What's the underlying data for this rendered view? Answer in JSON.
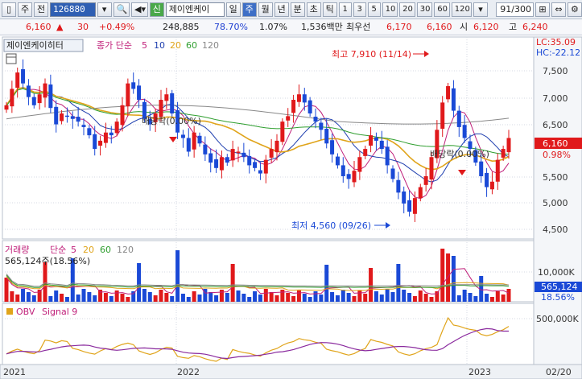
{
  "toolbar": {
    "mode": "주",
    "prev_label": "전",
    "code": "126880",
    "shin_label": "신",
    "stock_name": "제이엔케이",
    "periods": [
      "일",
      "주",
      "월",
      "년",
      "분",
      "초",
      "틱"
    ],
    "active_period": "주",
    "intervals": [
      "1",
      "3",
      "5",
      "10",
      "20",
      "30",
      "60",
      "120"
    ],
    "count": "91",
    "count_total": "/300"
  },
  "quote": {
    "price": "6,160",
    "change": "30",
    "change_pct": "+0.49%",
    "volume": "248,885",
    "ratio1": "78.70%",
    "ratio2": "1.07%",
    "amount": "1,536백만",
    "best_ask_label": "최우선",
    "best_ask": "6,170",
    "best_bid": "6,160",
    "open_label": "시",
    "open": "6,120",
    "high_label": "고",
    "high": "6,240"
  },
  "chart_labels": {
    "stock": "제이엔케이히터",
    "ma_label": "종가 단순",
    "ma_periods": [
      "5",
      "10",
      "20",
      "60",
      "120"
    ],
    "lc": "LC:35.09",
    "hc": "HC:-22.12",
    "high_annot": "최고 7,910 (11/14)",
    "low_annot": "최저 4,560 (09/26)",
    "dividend1": "배당락(0.00%)",
    "dividend2": "배당락(0.00%)",
    "price_tag": "6,160",
    "pct_tag": "0.98%",
    "price_ticks": [
      "7,500",
      "7,000",
      "6,500",
      "5,500",
      "5,000",
      "4,500"
    ],
    "vol_label": "거래량",
    "vol_ma_label": "단순",
    "vol_ma_periods": [
      "5",
      "20",
      "60",
      "120"
    ],
    "vol_value": "565,124주(18.56%)",
    "vol_tick": "10,000K",
    "vol_tag": "565,124",
    "vol_pct_tag": "18.56%",
    "obv_label": "OBV",
    "obv_signal": "Signal 9",
    "obv_tick": "500,000K",
    "x_labels": [
      "2021",
      "2022",
      "2023",
      "02/20"
    ]
  },
  "colors": {
    "up": "#e0191b",
    "down": "#1a49d6",
    "ma5": "#c0207a",
    "ma10": "#1f3faf",
    "ma20": "#e0a41a",
    "ma60": "#2e9e2e",
    "ma120": "#888888"
  },
  "chart_data": {
    "type": "candlestick",
    "x_range": [
      "2021",
      "02/20"
    ],
    "price_range": [
      4300,
      8000
    ],
    "high_value": 7910,
    "low_value": 4560,
    "last_close": 6160
  }
}
